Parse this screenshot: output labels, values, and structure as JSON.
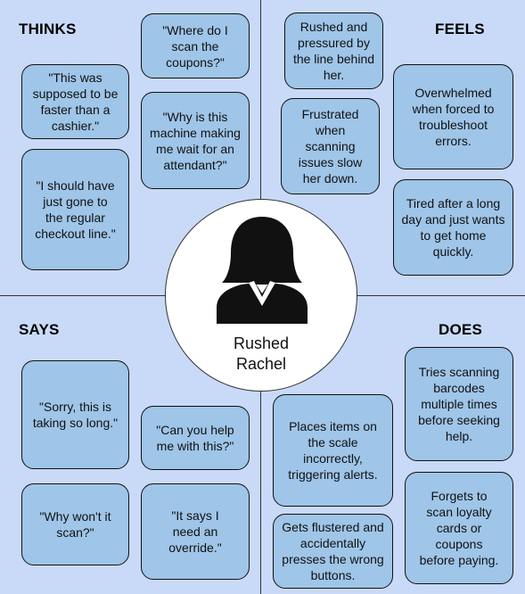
{
  "persona": {
    "name": "Rushed\nRachel",
    "icon": "woman-avatar-icon"
  },
  "colors": {
    "background": "#c9daf8",
    "card": "#9fc5e8",
    "border": "#111111",
    "circle": "#ffffff"
  },
  "quadrants": {
    "thinks": {
      "title": "THINKS",
      "cards": [
        "\"Where do I scan the coupons?\"",
        "\"This was supposed to be faster than a cashier.\"",
        "\"Why is this machine making me wait for an attendant?\"",
        "\"I should have just gone to the regular checkout line.\""
      ]
    },
    "feels": {
      "title": "FEELS",
      "cards": [
        "Rushed and pressured by the line behind her.",
        "Overwhelmed when forced to troubleshoot errors.",
        "Frustrated when scanning issues slow her down.",
        "Tired after a long day and just wants to get home quickly."
      ]
    },
    "says": {
      "title": "SAYS",
      "cards": [
        "\"Sorry, this is taking so long.\"",
        "\"Can you help me with this?\"",
        "\"Why won't it scan?\"",
        "\"It says I need an override.\""
      ]
    },
    "does": {
      "title": "DOES",
      "cards": [
        "Tries scanning barcodes multiple times before seeking help.",
        "Places items on the scale incorrectly, triggering alerts.",
        "Forgets to scan loyalty cards or coupons before paying.",
        "Gets flustered and accidentally presses the wrong buttons."
      ]
    }
  }
}
